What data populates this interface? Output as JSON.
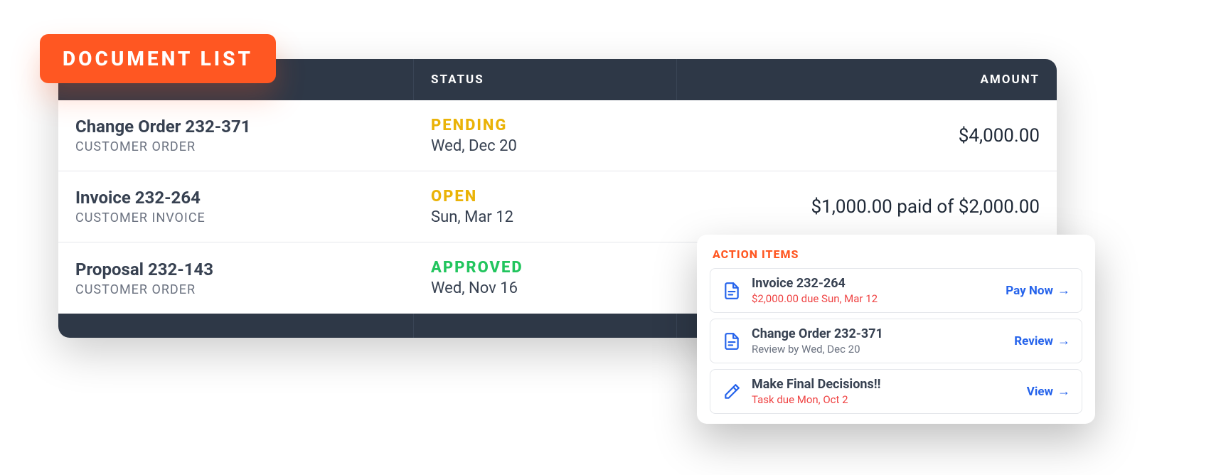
{
  "badge": "DOCUMENT LIST",
  "table": {
    "headers": {
      "status": "STATUS",
      "amount": "AMOUNT"
    },
    "rows": [
      {
        "title": "Change Order 232-371",
        "subtitle": "CUSTOMER ORDER",
        "status": "PENDING",
        "status_class": "status-pending",
        "date": "Wed, Dec 20",
        "amount": "$4,000.00"
      },
      {
        "title": "Invoice 232-264",
        "subtitle": "CUSTOMER INVOICE",
        "status": "OPEN",
        "status_class": "status-open",
        "date": "Sun, Mar 12",
        "amount": "$1,000.00 paid of $2,000.00"
      },
      {
        "title": "Proposal 232-143",
        "subtitle": "CUSTOMER ORDER",
        "status": "APPROVED",
        "status_class": "status-approved",
        "date": "Wed, Nov 16",
        "amount": ""
      }
    ]
  },
  "actions": {
    "title": "ACTION ITEMS",
    "items": [
      {
        "icon": "document-icon",
        "title": "Invoice 232-264",
        "subtitle": "$2,000.00 due  Sun, Mar 12",
        "sub_class": "t2-red",
        "link": "Pay Now"
      },
      {
        "icon": "document-icon",
        "title": "Change Order 232-371",
        "subtitle": "Review by Wed, Dec 20",
        "sub_class": "t2-grey",
        "link": "Review"
      },
      {
        "icon": "hammer-icon",
        "title": "Make Final Decisions!!",
        "subtitle": "Task due Mon, Oct 2",
        "sub_class": "t2-red",
        "link": "View"
      }
    ]
  }
}
